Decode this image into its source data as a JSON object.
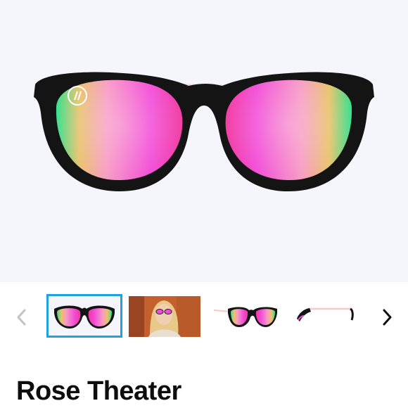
{
  "product": {
    "title": "Rose Theater",
    "brand_mark": "//"
  },
  "gallery": {
    "selected_index": 0,
    "thumbnails": [
      {
        "kind": "front view"
      },
      {
        "kind": "worn by model"
      },
      {
        "kind": "front angled view"
      },
      {
        "kind": "side view"
      }
    ],
    "prev_icon": "chevron-left-icon",
    "next_icon": "chevron-right-icon"
  },
  "colors": {
    "lens_pink": "#f24bd8",
    "lens_green": "#3ee89a",
    "frame": "#141414",
    "temple_pink": "#f6c9c4",
    "selected_border": "#1fa3dc",
    "hero_bg": "#f4f6fb"
  }
}
